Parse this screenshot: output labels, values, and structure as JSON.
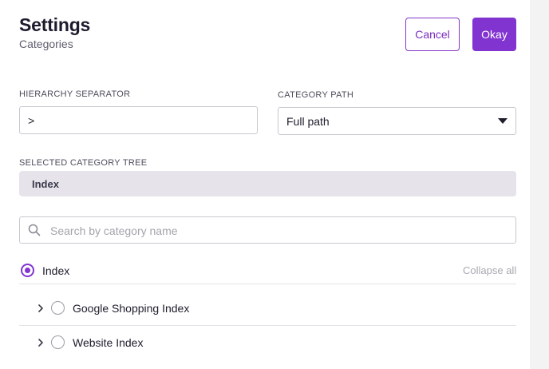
{
  "header": {
    "title": "Settings",
    "subtitle": "Categories",
    "cancel_label": "Cancel",
    "okay_label": "Okay"
  },
  "hierarchy_separator": {
    "label": "HIERARCHY SEPARATOR",
    "value": ">"
  },
  "category_path": {
    "label": "CATEGORY PATH",
    "value": "Full path"
  },
  "selected_tree": {
    "label": "SELECTED CATEGORY TREE",
    "value": "Index"
  },
  "search": {
    "placeholder": "Search by category name"
  },
  "tree": {
    "root_label": "Index",
    "collapse_label": "Collapse all",
    "items": [
      {
        "label": "Google Shopping Index"
      },
      {
        "label": "Website Index"
      }
    ]
  },
  "colors": {
    "accent": "#8234d1",
    "chip_bg": "#e6e3eb"
  },
  "icons": [
    "search-icon",
    "chevron-right-icon",
    "dropdown-caret-icon"
  ]
}
